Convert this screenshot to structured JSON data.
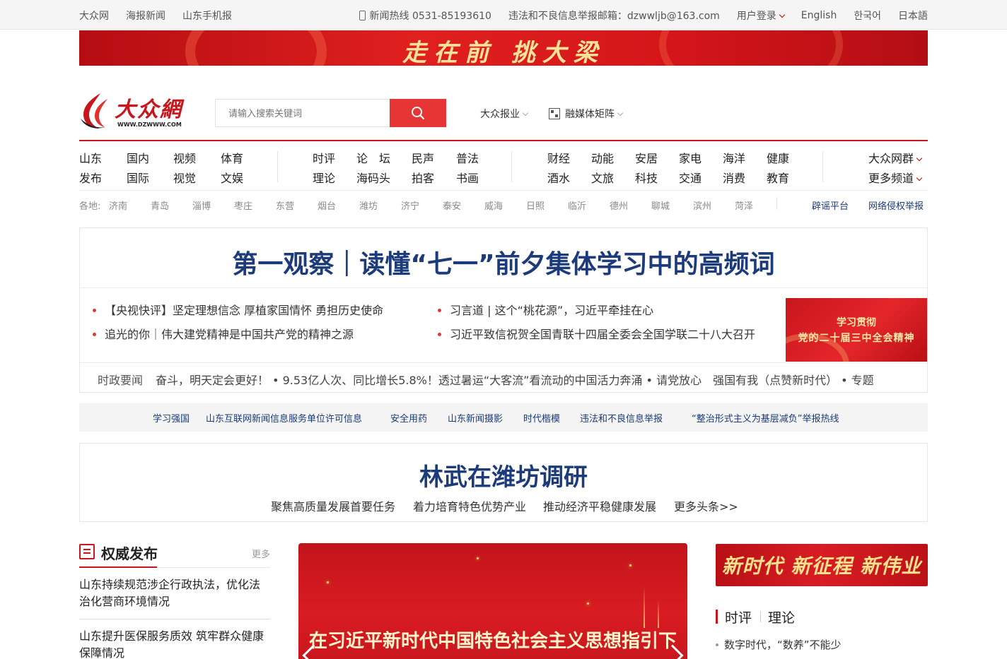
{
  "topbar": {
    "left_links": [
      "大众网",
      "海报新闻",
      "山东手机报"
    ],
    "hotline": "新闻热线 0531-85193610",
    "report_email": "违法和不良信息举报邮箱：dzwwljb@163.com",
    "login": "用户登录",
    "languages": [
      "English",
      "한국어",
      "日本語"
    ]
  },
  "banner": {
    "text": "走在前 挑大梁"
  },
  "logo": {
    "name": "大众網",
    "url": "WWW.DZWWW.COM"
  },
  "search": {
    "placeholder": "请输入搜索关键词"
  },
  "header_links": {
    "paper": "大众报业",
    "media": "融媒体矩阵"
  },
  "nav": {
    "group1": [
      [
        "山东",
        "发布"
      ],
      [
        "国内",
        "国际"
      ],
      [
        "视频",
        "视觉"
      ],
      [
        "体育",
        "文娱"
      ]
    ],
    "group2": [
      [
        "时评",
        "理论"
      ],
      [
        "论　坛",
        "海码头"
      ],
      [
        "民声",
        "拍客"
      ],
      [
        "普法",
        "书画"
      ]
    ],
    "group3": [
      [
        "财经",
        "酒水"
      ],
      [
        "动能",
        "文旅"
      ],
      [
        "安居",
        "科技"
      ],
      [
        "家电",
        "交通"
      ],
      [
        "海洋",
        "消费"
      ],
      [
        "健康",
        "教育"
      ]
    ],
    "more": [
      "大众网群",
      "更多频道"
    ]
  },
  "regions": {
    "label": "各地:",
    "cities": [
      "济南",
      "青岛",
      "淄博",
      "枣庄",
      "东营",
      "烟台",
      "潍坊",
      "济宁",
      "泰安",
      "威海",
      "日照",
      "临沂",
      "德州",
      "聊城",
      "滨州",
      "菏泽"
    ],
    "links": [
      "辟谣平台",
      "网络侵权举报"
    ]
  },
  "headline": {
    "title": "第一观察｜读懂“七一”前夕集体学习中的高频词",
    "items": [
      "【央视快评】坚定理想信念 厚植家国情怀 勇担历史使命",
      "习言道 | 这个“桃花源”，习近平牵挂在心",
      "追光的你｜伟大建党精神是中国共产党的精神之源",
      "习近平致信祝贺全国青联十四届全委会全国学联二十八大召开"
    ],
    "promo_line1": "学习贯彻",
    "promo_line2": "党的二十届三中全会精神",
    "ticker_label": "时政要闻",
    "ticker_text": "奋斗，明天定会更好！ • 9.53亿人次、同比增长5.8%！透过暑运“大客流”看流动的中国活力奔涌 • 请党放心　强国有我（点赞新时代） • 专题"
  },
  "strip_links": [
    "学习强国",
    "山东互联网新闻信息服务单位许可信息",
    "安全用药",
    "山东新闻摄影",
    "时代楷模",
    "违法和不良信息举报",
    "“整治形式主义为基层减负”举报热线"
  ],
  "headline2": {
    "title": "林武在潍坊调研",
    "subs": [
      "聚焦高质量发展首要任务",
      "着力培育特色优势产业",
      "推动经济平稳健康发展",
      "更多头条>>"
    ]
  },
  "authority": {
    "title": "权威发布",
    "more": "更多",
    "items": [
      "山东持续规范涉企行政执法，优化法治化营商环境情况",
      "山东提升医保服务质效 筑牢群众健康保障情况"
    ]
  },
  "feature": {
    "text": "在习近平新时代中国特色社会主义思想指引下"
  },
  "right": {
    "banner": "新时代 新征程 新伟业",
    "tab1": "时评",
    "tab2": "理论",
    "news": "数字时代，“数养”不能少"
  },
  "colors": {
    "brand_red": "#c8161d",
    "headline_blue": "#1c3b7b",
    "link_blue": "#1a3a7a"
  }
}
